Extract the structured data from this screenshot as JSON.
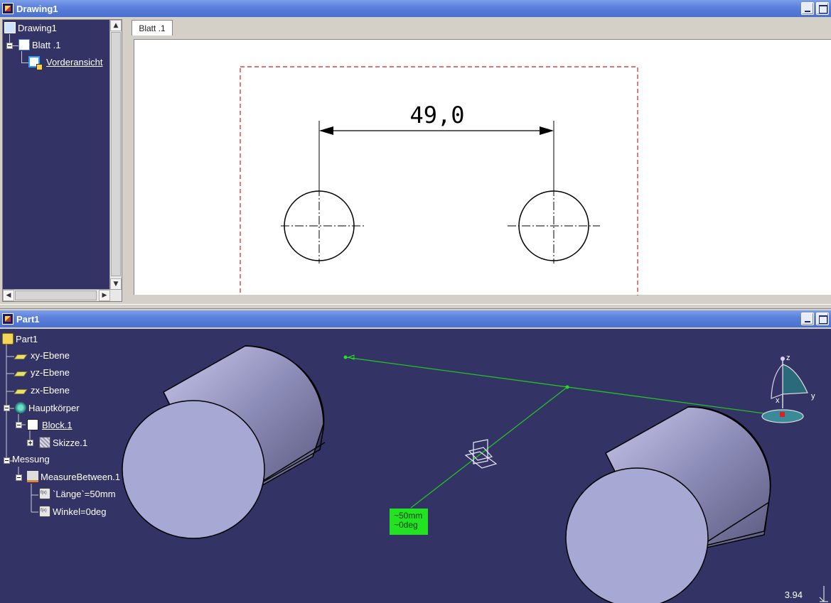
{
  "drawing_window": {
    "title": "Drawing1",
    "tree": {
      "root": "Drawing1",
      "sheet": "Blatt .1",
      "view": "Vorderansicht"
    },
    "sheet_tab": "Blatt .1",
    "dimension_text": "49,0"
  },
  "part_window": {
    "title": "Part1",
    "tree": {
      "root": "Part1",
      "plane_xy": "xy-Ebene",
      "plane_yz": "yz-Ebene",
      "plane_zx": "zx-Ebene",
      "body": "Hauptkörper",
      "block": "Block.1",
      "sketch": "Skizze.1",
      "measure_group": "Messung",
      "measure": "MeasureBetween.1",
      "length_param": "`Länge`=50mm",
      "angle_param": "Winkel=0deg"
    },
    "measure_label": {
      "line1": "~50mm",
      "line2": "~0deg"
    },
    "compass": {
      "z": "z",
      "x": "x",
      "y": "y"
    },
    "zoom_readout": "3.94"
  },
  "colors": {
    "viewport_bg": "#333366",
    "titlebar": "#5c82dc",
    "measure_green": "#22e222",
    "frame_red": "#d42020"
  }
}
